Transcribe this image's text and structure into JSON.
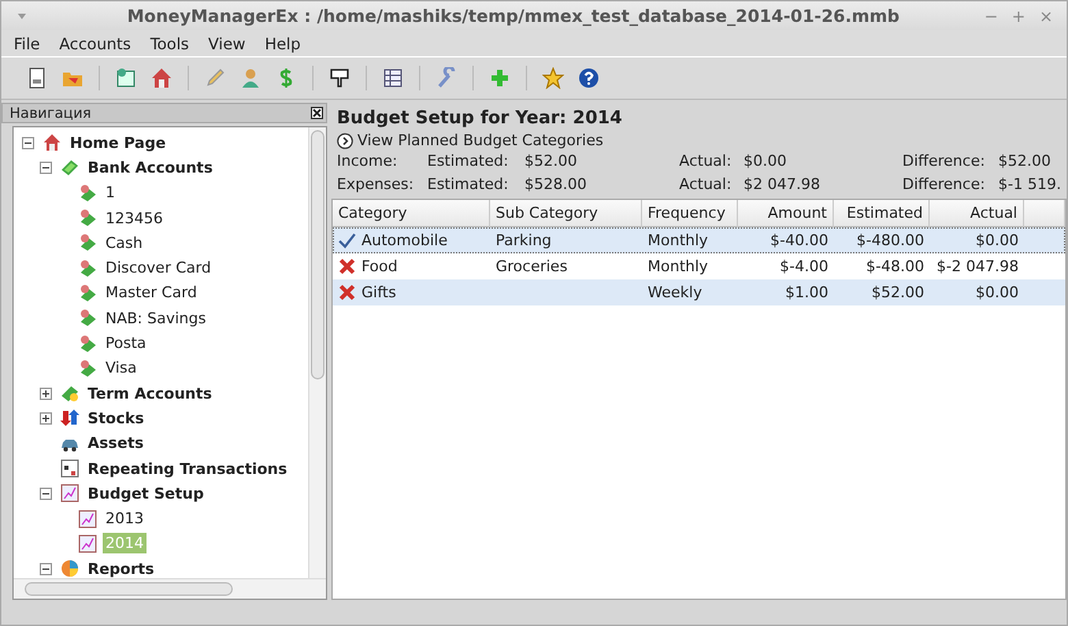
{
  "window": {
    "title": "MoneyManagerEx : /home/mashiks/temp/mmex_test_database_2014-01-26.mmb",
    "controls": [
      "−",
      "+",
      "×"
    ]
  },
  "menu": [
    "File",
    "Accounts",
    "Tools",
    "View",
    "Help"
  ],
  "navigation": {
    "title": "Навигация",
    "tree": [
      {
        "label": "Home Page",
        "kind": "home",
        "expanded": true,
        "selected": false,
        "children": [
          {
            "label": "Bank Accounts",
            "kind": "bank",
            "expanded": true,
            "selected": false,
            "children": [
              {
                "label": "1",
                "kind": "account",
                "selected": false
              },
              {
                "label": "123456",
                "kind": "account",
                "selected": false
              },
              {
                "label": "Cash",
                "kind": "account",
                "selected": false
              },
              {
                "label": "Discover Card",
                "kind": "account",
                "selected": false
              },
              {
                "label": "Master Card",
                "kind": "account",
                "selected": false
              },
              {
                "label": "NAB: Savings",
                "kind": "account",
                "selected": false
              },
              {
                "label": "Posta",
                "kind": "account",
                "selected": false
              },
              {
                "label": "Visa",
                "kind": "account",
                "selected": false
              }
            ]
          },
          {
            "label": "Term Accounts",
            "kind": "term",
            "expanded": false,
            "selected": false
          },
          {
            "label": "Stocks",
            "kind": "stocks",
            "expanded": false,
            "selected": false
          },
          {
            "label": "Assets",
            "kind": "assets",
            "selected": false
          },
          {
            "label": "Repeating Transactions",
            "kind": "repeating",
            "selected": false
          },
          {
            "label": "Budget Setup",
            "kind": "budget",
            "expanded": true,
            "selected": false,
            "children": [
              {
                "label": "2013",
                "kind": "budget",
                "selected": false
              },
              {
                "label": "2014",
                "kind": "budget",
                "selected": true
              }
            ]
          },
          {
            "label": "Reports",
            "kind": "reports",
            "expanded": true,
            "selected": false
          }
        ]
      }
    ]
  },
  "budget": {
    "title": "Budget Setup for Year: 2014",
    "link": "View Planned Budget Categories",
    "summary": [
      {
        "label": "Income:",
        "estimated_label": "Estimated:",
        "estimated": "$52.00",
        "actual_label": "Actual:",
        "actual": "$0.00",
        "difference_label": "Difference:",
        "difference": "$52.00"
      },
      {
        "label": "Expenses:",
        "estimated_label": "Estimated:",
        "estimated": "$528.00",
        "actual_label": "Actual:",
        "actual": "$2 047.98",
        "difference_label": "Difference:",
        "difference": "$-1 519."
      }
    ],
    "table": {
      "columns": [
        "Category",
        "Sub Category",
        "Frequency",
        "Amount",
        "Estimated",
        "Actual"
      ],
      "rows": [
        {
          "kind": "check",
          "selected": true,
          "cells": [
            "Automobile",
            "Parking",
            "Monthly",
            "$-40.00",
            "$-480.00",
            "$0.00"
          ]
        },
        {
          "kind": "cross",
          "selected": false,
          "cells": [
            "Food",
            "Groceries",
            "Monthly",
            "$-4.00",
            "$-48.00",
            "$-2 047.98"
          ]
        },
        {
          "kind": "cross",
          "selected": false,
          "cells": [
            "Gifts",
            "",
            "Weekly",
            "$1.00",
            "$52.00",
            "$0.00"
          ]
        }
      ]
    }
  }
}
